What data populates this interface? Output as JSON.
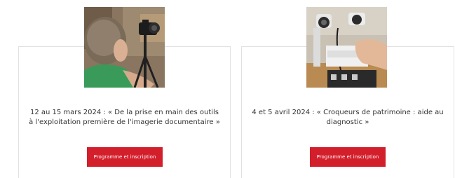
{
  "cards": [
    {
      "title": "12 au 15 mars 2024 : « De la prise en main des outils à l'exploitation première de l'imagerie documentaire »",
      "button_label": "Programme et inscription",
      "image_icon": "photographer-image"
    },
    {
      "title": "4 et 5 avril 2024 : « Croqueurs de patrimoine : aide au diagnostic »",
      "button_label": "Programme et inscription",
      "image_icon": "microscope-image"
    }
  ],
  "colors": {
    "accent": "#d31f2b",
    "card_border": "#e1e1e1",
    "text": "#333333"
  }
}
